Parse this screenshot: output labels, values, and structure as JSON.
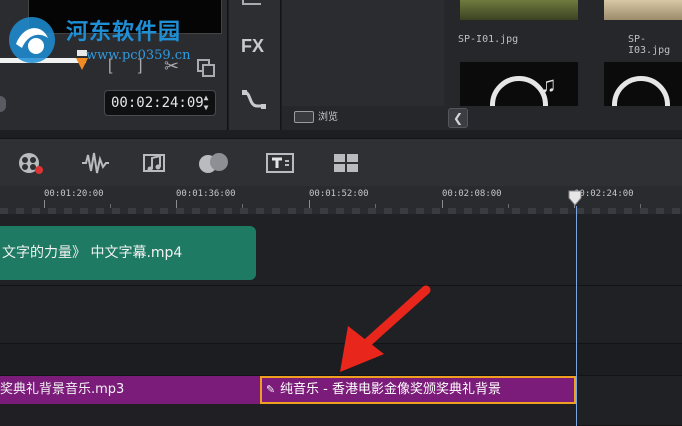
{
  "preview": {
    "timecode": "00:02:24:09",
    "mark_in": "[",
    "mark_out": "]"
  },
  "side_toolbar": {
    "fx_label": "FX"
  },
  "library": {
    "thumbnails": [
      {
        "filename": "SP-I01.jpg"
      },
      {
        "filename": "SP-I03.jpg"
      }
    ],
    "browse_label": "浏览"
  },
  "watermark": {
    "title": "河东软件园",
    "url": "www.pc0359.cn"
  },
  "ruler": {
    "labels": [
      "00:01:20:00",
      "00:01:36:00",
      "00:01:52:00",
      "00:02:08:00",
      "00:02:24:00"
    ]
  },
  "clips": {
    "title_clip": "文字的力量》 中文字幕.mp4",
    "audio_clip_1": "奖典礼背景音乐.mp3",
    "audio_clip_2": "纯音乐 - 香港电影金像奖颁奖典礼背景"
  },
  "colors": {
    "title_clip": "#1f7a63",
    "audio_clip": "#7b1c7a",
    "selection_border": "#f0a020",
    "playhead": "#7aa7e0",
    "annotation_arrow": "#e8261c"
  }
}
